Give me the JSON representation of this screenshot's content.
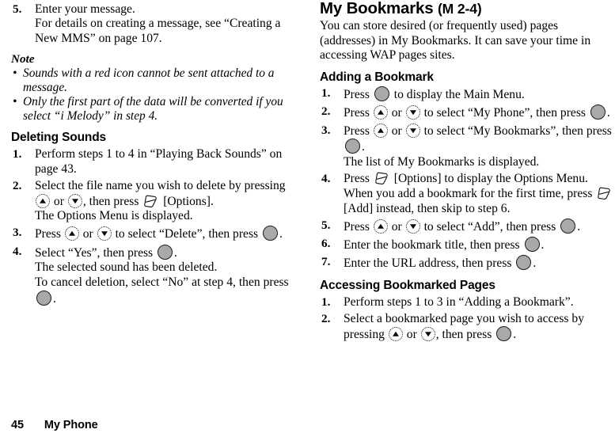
{
  "footer": {
    "page_number": "45",
    "section_name": "My Phone"
  },
  "icons": {
    "center_key": "center-select-key-icon",
    "nav_up": "navigation-up-key-icon",
    "nav_down": "navigation-down-key-icon",
    "soft_key": "left-soft-key-icon",
    "bullet": "•"
  },
  "left_column": {
    "step5": {
      "number": "5.",
      "text": "Enter your message.",
      "detail": "For details on creating a message, see “Creating a New MMS” on page 107."
    },
    "note": {
      "title": "Note",
      "items": [
        "Sounds with a red icon cannot be sent attached to a message.",
        "Only the first part of the data will be converted if you select “i Melody” in step 4."
      ]
    },
    "deleting_sounds": {
      "heading": "Deleting Sounds",
      "steps": [
        {
          "number": "1.",
          "text": "Perform steps 1 to 4 in “Playing Back Sounds” on page 43."
        },
        {
          "number": "2.",
          "text_before": "Select the file name you wish to delete by pressing",
          "text_mid": "or",
          "text_after": ", then press",
          "text_end": "[Options].",
          "detail": "The Options Menu is displayed."
        },
        {
          "number": "3.",
          "text_before": "Press",
          "text_mid": "or",
          "text_after": "to select “Delete”, then press",
          "text_end": "."
        },
        {
          "number": "4.",
          "text_before": "Select “Yes”, then press",
          "text_end": ".",
          "detail1": "The selected sound has been deleted.",
          "detail2": "To cancel deletion, select “No” at step 4, then press",
          "detail2_end": "."
        }
      ]
    }
  },
  "right_column": {
    "title": "My Bookmarks",
    "title_code": "(M 2-4)",
    "intro": "You can store desired (or frequently used) pages (addresses) in My Bookmarks. It can save your time in accessing WAP pages sites.",
    "adding": {
      "heading": "Adding a Bookmark",
      "steps": [
        {
          "number": "1.",
          "text_before": "Press",
          "text_after": "to display the Main Menu."
        },
        {
          "number": "2.",
          "text_before": "Press",
          "text_mid": "or",
          "text_after": "to select “My Phone”, then press",
          "text_end": "."
        },
        {
          "number": "3.",
          "text_before": "Press",
          "text_mid": "or",
          "text_after": "to select “My Bookmarks”, then press",
          "text_end": ".",
          "detail": "The list of My Bookmarks is displayed."
        },
        {
          "number": "4.",
          "text_before": "Press",
          "text_after": "[Options] to display the Options Menu.",
          "detail_before": "When you add a bookmark for the first time, press",
          "detail_after": "[Add] instead, then skip to step 6."
        },
        {
          "number": "5.",
          "text_before": "Press",
          "text_mid": "or",
          "text_after": "to select “Add”, then press",
          "text_end": "."
        },
        {
          "number": "6.",
          "text_before": "Enter the bookmark title, then press",
          "text_end": "."
        },
        {
          "number": "7.",
          "text_before": "Enter the URL address, then press",
          "text_end": "."
        }
      ]
    },
    "accessing": {
      "heading": "Accessing Bookmarked Pages",
      "steps": [
        {
          "number": "1.",
          "text": "Perform steps 1 to 3 in “Adding a Bookmark”."
        },
        {
          "number": "2.",
          "text_before": "Select a bookmarked page you wish to access by pressing",
          "text_mid": "or",
          "text_after": ", then press",
          "text_end": "."
        }
      ]
    }
  }
}
